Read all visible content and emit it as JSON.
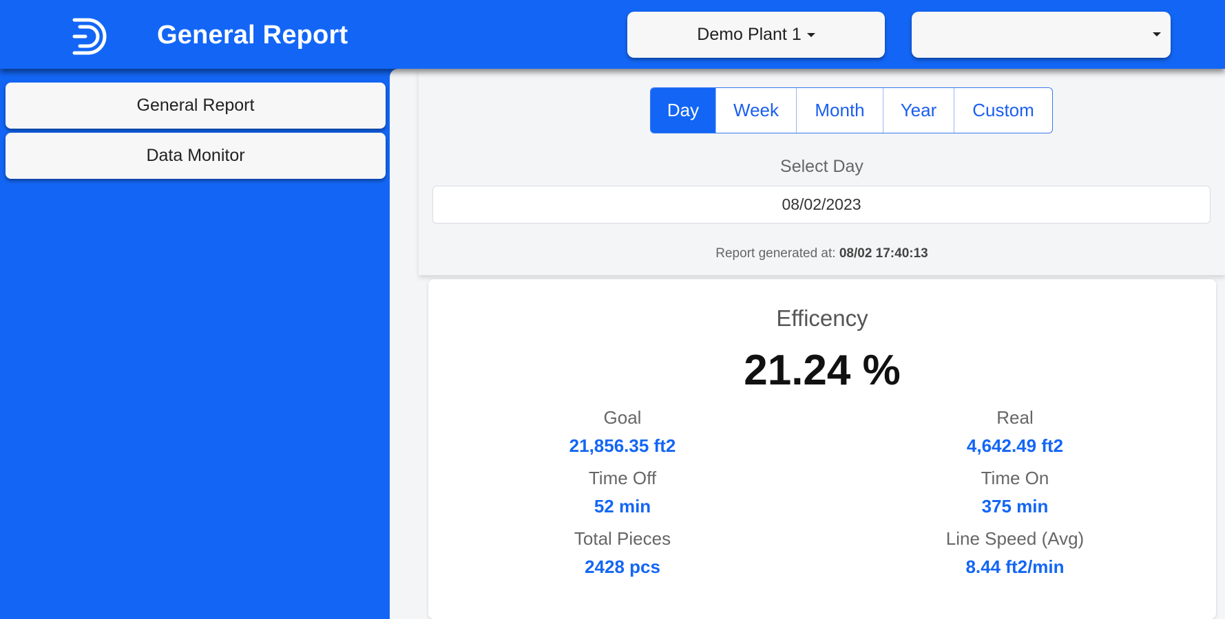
{
  "header": {
    "title": "General Report",
    "plant_select": {
      "value": "Demo Plant 1"
    },
    "second_select": {
      "value": ""
    }
  },
  "sidebar": {
    "items": [
      {
        "label": "General Report"
      },
      {
        "label": "Data Monitor"
      }
    ]
  },
  "filters": {
    "tabs": [
      {
        "label": "Day",
        "active": true
      },
      {
        "label": "Week",
        "active": false
      },
      {
        "label": "Month",
        "active": false
      },
      {
        "label": "Year",
        "active": false
      },
      {
        "label": "Custom",
        "active": false
      }
    ],
    "select_day_label": "Select Day",
    "date_value": "08/02/2023",
    "report_generated_label": "Report generated at:",
    "report_generated_value": "08/02 17:40:13"
  },
  "efficiency": {
    "title": "Efficency",
    "value": "21.24 %",
    "metrics": {
      "goal": {
        "label": "Goal",
        "value": "21,856.35 ft2"
      },
      "real": {
        "label": "Real",
        "value": "4,642.49 ft2"
      },
      "time_off": {
        "label": "Time Off",
        "value": "52 min"
      },
      "time_on": {
        "label": "Time On",
        "value": "375 min"
      },
      "total_pieces": {
        "label": "Total Pieces",
        "value": "2428 pcs"
      },
      "line_speed": {
        "label": "Line Speed (Avg)",
        "value": "8.44 ft2/min"
      }
    }
  },
  "colors": {
    "brand_blue": "#1366f5",
    "panel_bg": "#f4f5f7"
  }
}
